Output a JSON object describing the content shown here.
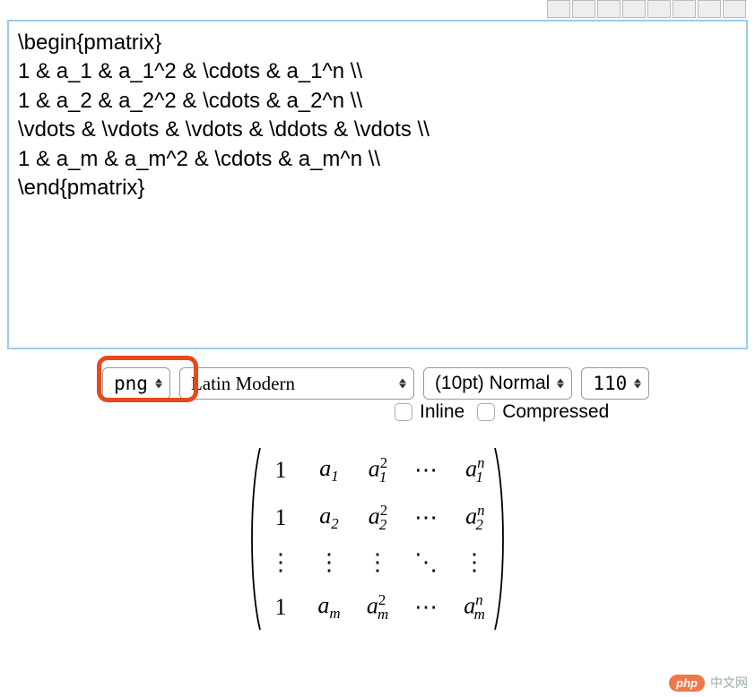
{
  "toolbar_buttons": [
    "t1",
    "t2",
    "t3",
    "t4",
    "t5",
    "t6",
    "t7",
    "t8"
  ],
  "editor": {
    "content": "\\begin{pmatrix}\n1 & a_1 & a_1^2 & \\cdots & a_1^n \\\\\n1 & a_2 & a_2^2 & \\cdots & a_2^n \\\\\n\\vdots & \\vdots & \\vdots & \\ddots & \\vdots \\\\\n1 & a_m & a_m^2 & \\cdots & a_m^n \\\\\n\\end{pmatrix}"
  },
  "controls": {
    "format": {
      "selected": "png"
    },
    "font": {
      "selected": "Latin Modern"
    },
    "size": {
      "selected": "(10pt) Normal"
    },
    "zoom": {
      "selected": "110"
    },
    "inline": {
      "label": "Inline",
      "checked": false
    },
    "compressed": {
      "label": "Compressed",
      "checked": false
    }
  },
  "matrix": {
    "rows": [
      [
        "1",
        "a_1",
        "a_1^2",
        "\\cdots",
        "a_1^n"
      ],
      [
        "1",
        "a_2",
        "a_2^2",
        "\\cdots",
        "a_2^n"
      ],
      [
        "\\vdots",
        "\\vdots",
        "\\vdots",
        "\\ddots",
        "\\vdots"
      ],
      [
        "1",
        "a_m",
        "a_m^2",
        "\\cdots",
        "a_m^n"
      ]
    ]
  },
  "watermark": {
    "badge": "php",
    "text": "中文网"
  }
}
